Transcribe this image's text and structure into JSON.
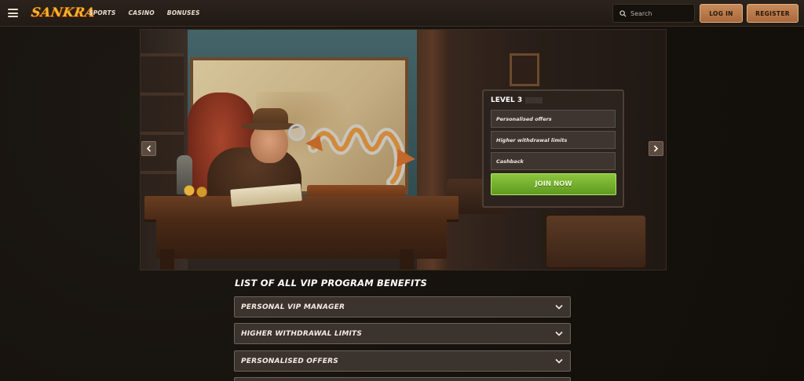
{
  "header": {
    "logo": "SANKRA",
    "nav": [
      "SPORTS",
      "CASINO",
      "BONUSES"
    ],
    "search_placeholder": "Search",
    "login_label": "LOG IN",
    "register_label": "REGISTER"
  },
  "level_card": {
    "title": "LEVEL 3",
    "items": [
      "Personalised offers",
      "Higher withdrawal limits",
      "Cashback"
    ],
    "cta": "JOIN NOW"
  },
  "benefits": {
    "title": "LIST OF ALL VIP PROGRAM BENEFITS",
    "items": [
      "PERSONAL VIP MANAGER",
      "HIGHER WITHDRAWAL LIMITS",
      "PERSONALISED OFFERS",
      ""
    ]
  },
  "colors": {
    "accent": "#c98a5a",
    "cta": "#7bb534",
    "logo": "#f2b62a"
  }
}
